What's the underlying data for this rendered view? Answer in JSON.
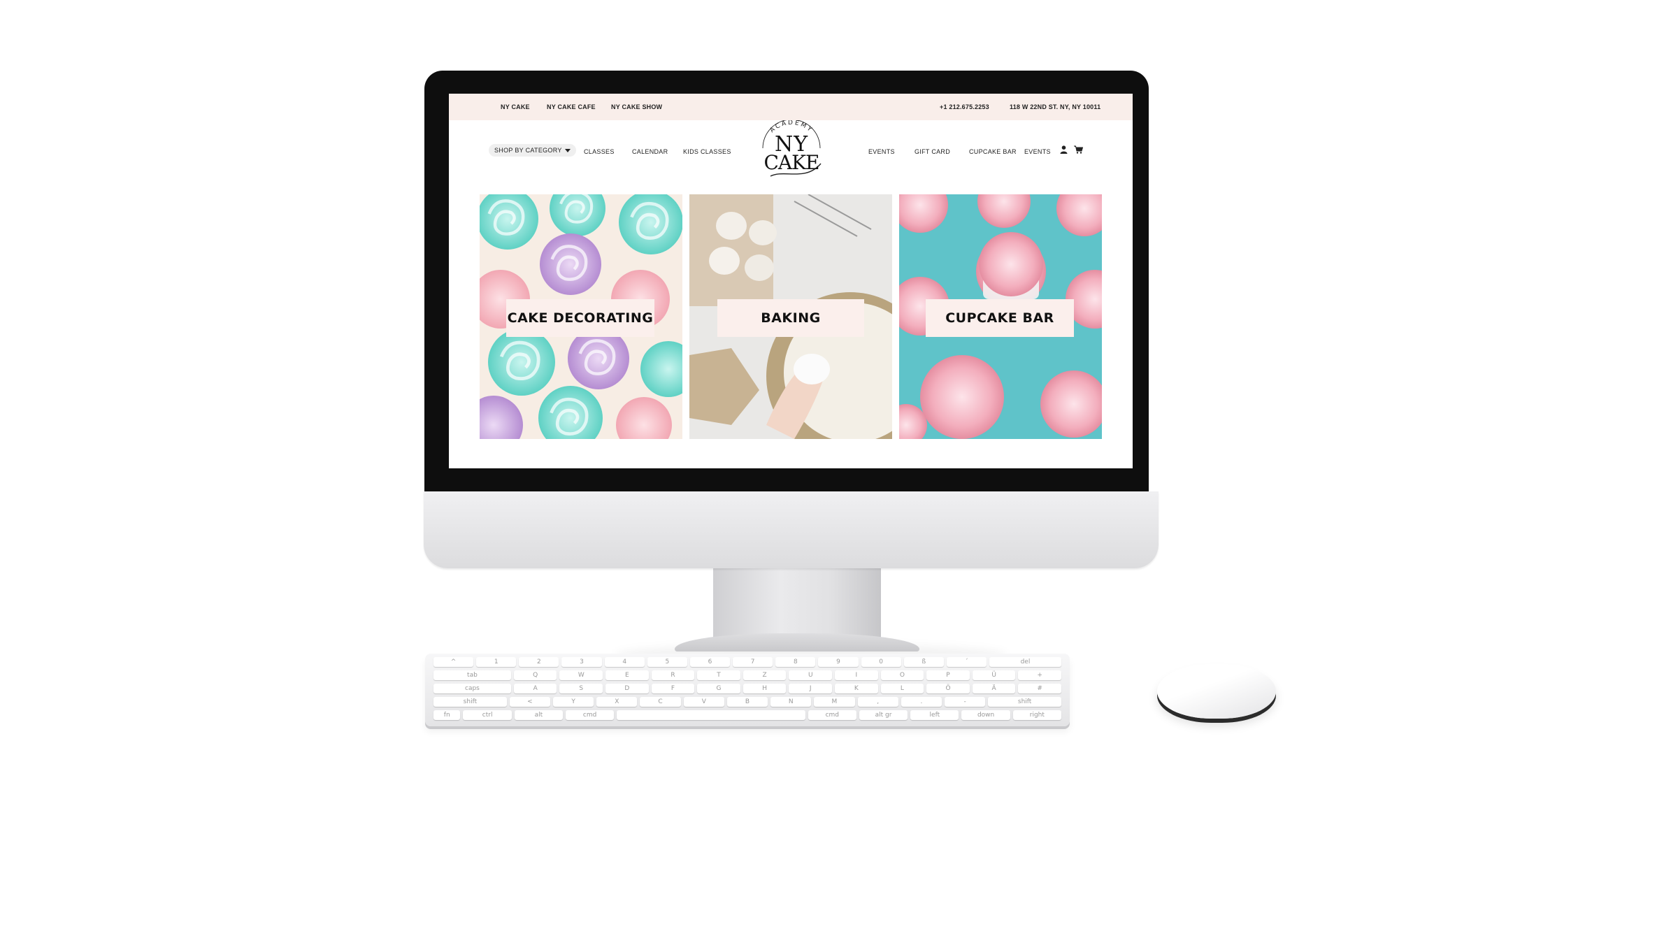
{
  "top_bar": {
    "links": [
      "NY CAKE",
      "NY CAKE CAFE",
      "NY CAKE SHOW"
    ],
    "phone": "+1 212.675.2253",
    "address": "118 W 22ND ST. NY, NY 10011"
  },
  "nav": {
    "shop_by_category": "SHOP BY CATEGORY",
    "left_links": [
      "CLASSES",
      "CALENDAR",
      "KIDS CLASSES"
    ],
    "right_links": [
      "EVENTS",
      "GIFT CARD",
      "CUPCAKE BAR",
      "EVENTS"
    ]
  },
  "logo": {
    "arc": "ACADEMY",
    "line1": "NY",
    "line2": "CAKE"
  },
  "tiles": [
    {
      "label": "CAKE DECORATING"
    },
    {
      "label": "BAKING"
    },
    {
      "label": "CUPCAKE BAR"
    }
  ],
  "colors": {
    "topbar_bg": "#f9eeea",
    "label_bg": "#fbefec",
    "frosting_teal": "#6fd8cc",
    "frosting_purple": "#c8a2dc",
    "frosting_pink": "#f4b3bd",
    "cupcake_bg": "#5fc3c9"
  },
  "keyboard": {
    "row1": [
      "^",
      "1",
      "2",
      "3",
      "4",
      "5",
      "6",
      "7",
      "8",
      "9",
      "0",
      "ß",
      "´",
      "del"
    ],
    "row2": [
      "tab",
      "Q",
      "W",
      "E",
      "R",
      "T",
      "Z",
      "U",
      "I",
      "O",
      "P",
      "Ü",
      "+"
    ],
    "row3": [
      "caps",
      "A",
      "S",
      "D",
      "F",
      "G",
      "H",
      "J",
      "K",
      "L",
      "Ö",
      "Ä",
      "#"
    ],
    "row4": [
      "shift",
      "<",
      "Y",
      "X",
      "C",
      "V",
      "B",
      "N",
      "M",
      ",",
      ".",
      "-",
      "shift"
    ],
    "row5": [
      "fn",
      "ctrl",
      "alt",
      "cmd",
      "",
      "cmd",
      "alt gr",
      "left",
      "down",
      "right"
    ]
  },
  "icons": {
    "account": "user-icon",
    "cart": "cart-icon"
  }
}
